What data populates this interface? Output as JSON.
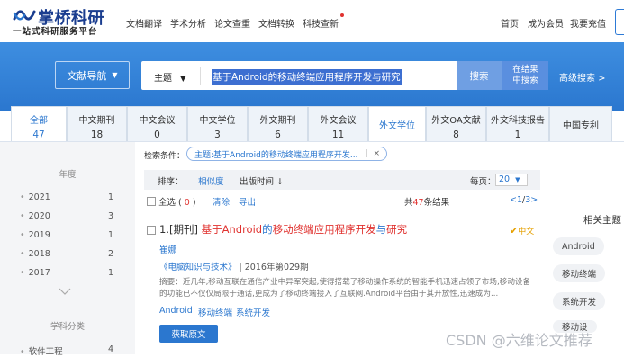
{
  "brand": {
    "title": "掌桥科研",
    "subtitle": "一站式科研服务平台"
  },
  "topnav": {
    "items": [
      "文档翻译",
      "学术分析",
      "论文查重",
      "文档转换",
      "科技查新"
    ],
    "right": [
      "首页",
      "成为会员",
      "我要充值"
    ]
  },
  "search": {
    "lit_nav_label": "文献导航",
    "field": "主题",
    "query": "基于Android的移动终端应用程序开发与研究",
    "search_button": "搜索",
    "in_result_button_line1": "在结果",
    "in_result_button_line2": "中搜索",
    "advanced": "高级搜索"
  },
  "tabs": [
    {
      "label": "全部",
      "count": "47"
    },
    {
      "label": "中文期刊",
      "count": "18"
    },
    {
      "label": "中文会议",
      "count": "0"
    },
    {
      "label": "中文学位",
      "count": "3"
    },
    {
      "label": "外文期刊",
      "count": "6"
    },
    {
      "label": "外文会议",
      "count": "11"
    },
    {
      "label": "外文学位",
      "count": ""
    },
    {
      "label": "外文OA文献",
      "count": "8"
    },
    {
      "label": "外文科技报告",
      "count": "1"
    },
    {
      "label": "中国专利",
      "count": ""
    }
  ],
  "sidebar": {
    "year_title": "年度",
    "years": [
      {
        "year": "2021",
        "count": "1"
      },
      {
        "year": "2020",
        "count": "3"
      },
      {
        "year": "2019",
        "count": "1"
      },
      {
        "year": "2018",
        "count": "2"
      },
      {
        "year": "2017",
        "count": "1"
      }
    ],
    "subject_title": "学科分类",
    "subjects": [
      {
        "name": "软件工程",
        "count": "4"
      }
    ]
  },
  "filter": {
    "label": "检索条件：",
    "chip": "主题:基于Android的移动终端应用程序开发...",
    "chip_sep": "|",
    "chip_close": "×"
  },
  "sort": {
    "label": "排序：",
    "relevance": "相似度",
    "date": "出版时间 ↓",
    "per_page_label": "每页：",
    "per_page_value": "20"
  },
  "actions": {
    "select_all": "全选",
    "selected_count": "0",
    "clear": "清除",
    "export": "导出",
    "total_prefix": "共",
    "total": "47",
    "total_suffix": "条结果",
    "page_current": "<1",
    "page_sep": "/",
    "page_total": "3>"
  },
  "result": {
    "index_type": "1.[期刊] ",
    "title_seg1": "基于Android",
    "title_seg2": "的",
    "title_seg3": "移动终端应用程序开发",
    "title_seg4": "与",
    "title_seg5": "研究",
    "oa_badge": "中文",
    "author": "崔娜",
    "source": "《电脑知识与技术》",
    "source_sep": " | ",
    "issue": "2016年第029期",
    "abstract": "摘要：近几年,移动互联在通信产业中异军突起,使得搭载了移动操作系统的智能手机迅速占领了市场,移动设备的功能已不仅仅局限于通话,更成为了移动终端接入了互联网.Android平台由于其开放性,迅速成为...",
    "keywords": [
      "Android",
      "移动终端",
      "系统开发"
    ],
    "fulltext_button": "获取原文"
  },
  "related": {
    "title": "相关主题",
    "tags": [
      "Android",
      "移动终端",
      "系统开发",
      "移动设"
    ]
  },
  "watermark": "CSDN @六维论文推荐"
}
